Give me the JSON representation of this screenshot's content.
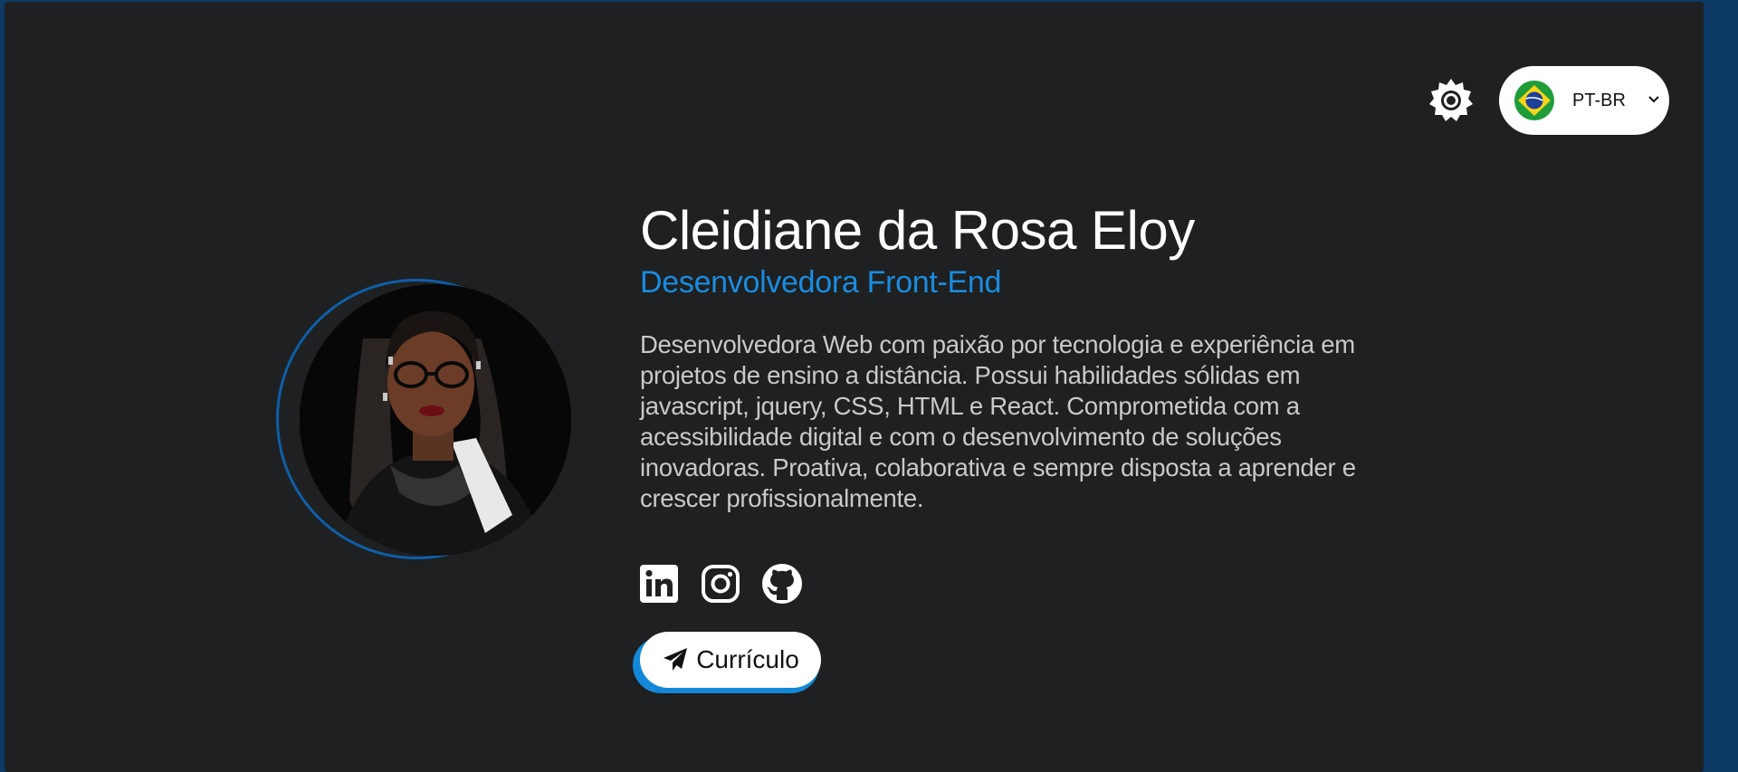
{
  "header": {
    "theme_toggle_icon": "sun-icon",
    "language": {
      "selected": "PT-BR",
      "flag_icon": "brazil-flag-icon",
      "chevron_icon": "chevron-down-icon"
    }
  },
  "profile": {
    "avatar_icon": "profile-photo",
    "name": "Cleidiane da Rosa Eloy",
    "role": "Desenvolvedora Front-End",
    "bio": "Desenvolvedora Web com paixão por tecnologia e experiência em projetos de ensino a distância. Possui habilidades sólidas em javascript, jquery, CSS, HTML e React. Comprometida com a acessibilidade digital e com o desenvolvimento de soluções inovadoras. Proativa, colaborativa e sempre disposta a aprender e crescer profissionalmente."
  },
  "socials": [
    {
      "icon": "linkedin-icon"
    },
    {
      "icon": "instagram-icon"
    },
    {
      "icon": "github-icon"
    }
  ],
  "cv_button": {
    "label": "Currículo",
    "icon": "paper-plane-icon"
  },
  "colors": {
    "background": "#1e2021",
    "accent": "#1a8ce0",
    "ring": "#0e5fa8",
    "text": "#ffffff",
    "bio_text": "#c9c9c9"
  }
}
